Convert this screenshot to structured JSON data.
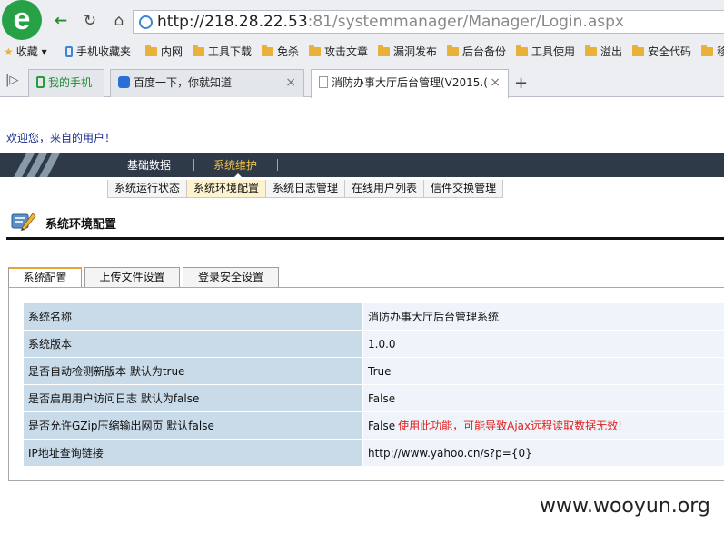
{
  "browser": {
    "logo_letter": "e",
    "url_host": "http://218.28.22.53",
    "url_rest": ":81/systemmanager/Manager/Login.aspx",
    "bookmarks": [
      {
        "label": "收藏",
        "icon": "star-icon"
      },
      {
        "label": "手机收藏夹",
        "icon": "phone-icon"
      },
      {
        "label": "内网",
        "icon": "folder-icon"
      },
      {
        "label": "工具下载",
        "icon": "folder-icon"
      },
      {
        "label": "免杀",
        "icon": "folder-icon"
      },
      {
        "label": "攻击文章",
        "icon": "folder-icon"
      },
      {
        "label": "漏洞发布",
        "icon": "folder-icon"
      },
      {
        "label": "后台备份",
        "icon": "folder-icon"
      },
      {
        "label": "工具使用",
        "icon": "folder-icon"
      },
      {
        "label": "溢出",
        "icon": "folder-icon"
      },
      {
        "label": "安全代码",
        "icon": "folder-icon"
      },
      {
        "label": "移",
        "icon": "folder-icon"
      }
    ],
    "tabs": [
      {
        "label": "我的手机"
      },
      {
        "label": "百度一下，你就知道"
      },
      {
        "label": "消防办事大厅后台管理(V2015.("
      }
    ]
  },
  "page": {
    "welcome": "欢迎您，来自的用户！",
    "topnav": [
      {
        "label": "基础数据"
      },
      {
        "label": "系统维护"
      }
    ],
    "subnav": [
      {
        "label": "系统运行状态"
      },
      {
        "label": "系统环境配置"
      },
      {
        "label": "系统日志管理"
      },
      {
        "label": "在线用户列表"
      },
      {
        "label": "信件交换管理"
      }
    ],
    "section_title": "系统环境配置",
    "tabs": [
      {
        "label": "系统配置"
      },
      {
        "label": "上传文件设置"
      },
      {
        "label": "登录安全设置"
      }
    ],
    "settings": [
      {
        "key": "系统名称",
        "value": "消防办事大厅后台管理系统",
        "note": ""
      },
      {
        "key": "系统版本",
        "value": "1.0.0",
        "note": ""
      },
      {
        "key": "是否自动检测新版本 默认为true",
        "value": "True",
        "note": ""
      },
      {
        "key": "是否启用用户访问日志 默认为false",
        "value": "False",
        "note": ""
      },
      {
        "key": "是否允许GZip压缩输出网页 默认false",
        "value": "False",
        "note": "使用此功能，可能导致Ajax远程读取数据无效!"
      },
      {
        "key": "IP地址查询链接",
        "value": "http://www.yahoo.cn/s?p={0}",
        "note": ""
      }
    ],
    "watermark": "www.wooyun.org"
  },
  "colors": {
    "nav_bg": "#2e3a47",
    "nav_active": "#f0c24a",
    "table_key_bg": "#c9dae9",
    "table_value_bg": "#eef4f9",
    "warning": "#e12020"
  }
}
